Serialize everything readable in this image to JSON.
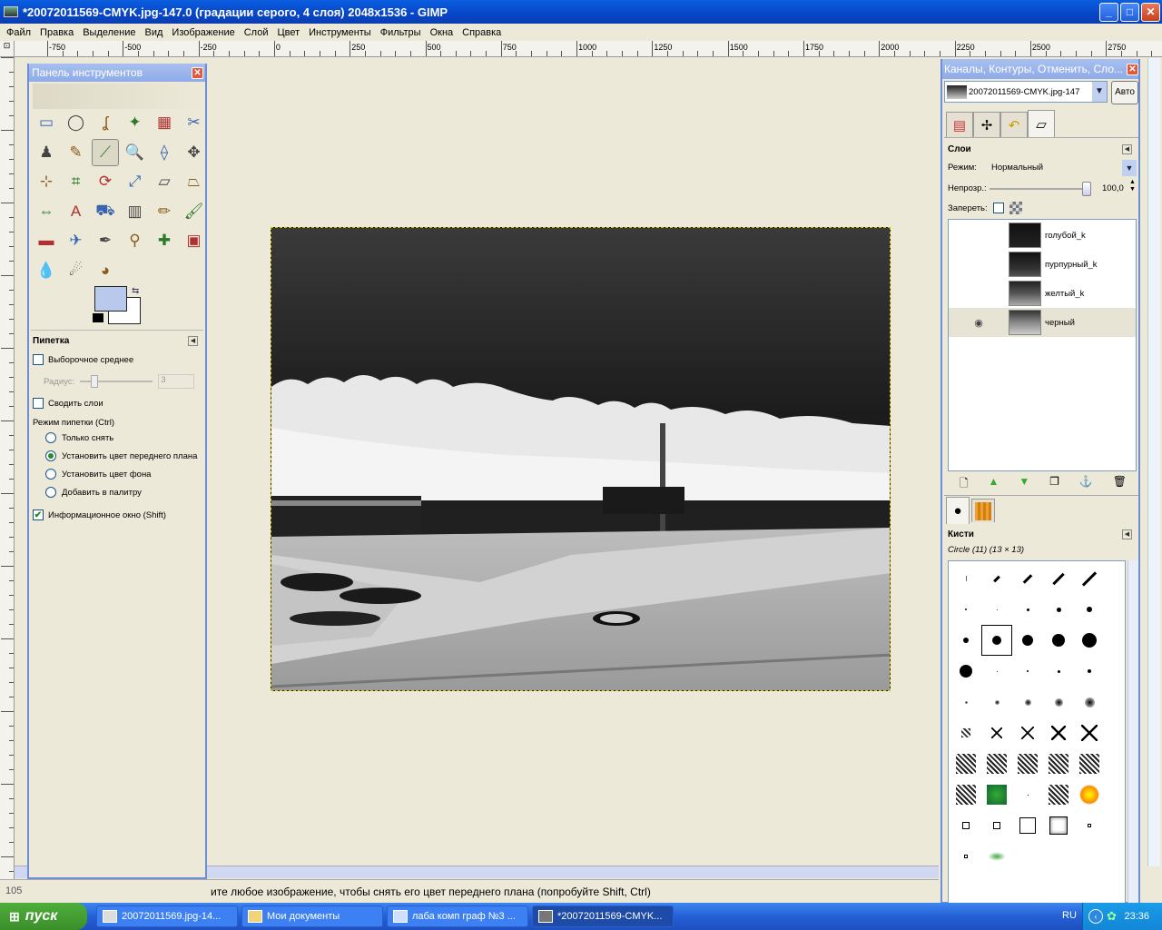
{
  "window": {
    "title": "*20072011569-CMYK.jpg-147.0 (градации серого, 4 слоя) 2048x1536 - GIMP",
    "controls": [
      "_",
      "□",
      "✕"
    ]
  },
  "menu": [
    "Файл",
    "Правка",
    "Выделение",
    "Вид",
    "Изображение",
    "Слой",
    "Цвет",
    "Инструменты",
    "Фильтры",
    "Окна",
    "Справка"
  ],
  "ruler": {
    "h_labels": [
      "-750",
      "-500",
      "-250",
      "0",
      "250",
      "500",
      "750",
      "1000",
      "1250",
      "1500",
      "1750",
      "2000",
      "2250",
      "2500",
      "2750"
    ]
  },
  "status": {
    "zoom": "105",
    "message": "ите любое изображение, чтобы снять его цвет переднего плана (попробуйте Shift, Ctrl)"
  },
  "toolbox": {
    "title": "Панель инструментов",
    "tools": [
      "rect-select",
      "ellipse-select",
      "free-select",
      "fuzzy-select",
      "select-by-color",
      "scissors",
      "foreground-select",
      "paths",
      "color-picker",
      "zoom",
      "measure",
      "move",
      "align",
      "crop",
      "rotate",
      "scale",
      "shear",
      "perspective",
      "flip",
      "text",
      "bucket-fill",
      "blend",
      "pencil",
      "paintbrush",
      "eraser",
      "airbrush",
      "ink",
      "clone",
      "heal",
      "perspective-clone",
      "blur",
      "smudge",
      "dodge-burn"
    ],
    "tool_glyphs": [
      "▭",
      "◯",
      "ʆ",
      "✦",
      "▦",
      "✂",
      "♟",
      "✎",
      "⟋",
      "🔍",
      "⟠",
      "✥",
      "⊹",
      "⌗",
      "⟳",
      "⤢",
      "▱",
      "⏢",
      "⇔",
      "A",
      "⛟",
      "▥",
      "✏",
      "🖌",
      "▬",
      "✈",
      "✒",
      "⚲",
      "✚",
      "▣",
      "💧",
      "☄",
      "◕"
    ],
    "fg_color": "#b8c9ec",
    "bg_color": "#ffffff",
    "options_title": "Пипетка",
    "sample_average": "Выборочное среднее",
    "radius_label": "Радиус:",
    "radius_value": "3",
    "sample_merged": "Сводить слои",
    "mode_title": "Режим пипетки  (Ctrl)",
    "modes": [
      "Только снять",
      "Установить цвет переднего плана",
      "Установить цвет фона",
      "Добавить в палитру"
    ],
    "selected_mode": 1,
    "info_window": "Информационное окно  (Shift)"
  },
  "dock": {
    "title": "Каналы, Контуры, Отменить, Сло...",
    "image_select": "20072011569-CMYK.jpg-147",
    "auto_button": "Авто",
    "tabs": [
      "channels-icon",
      "paths-icon",
      "undo-icon",
      "layers-icon"
    ],
    "layers_title": "Слои",
    "mode_label": "Режим:",
    "mode_value": "Нормальный",
    "opacity_label": "Непрозр.:",
    "opacity_value": "100,0",
    "opacity_fraction": 1.0,
    "lock_label": "Запереть:",
    "layers": [
      {
        "name": "голубой_k",
        "visible": false
      },
      {
        "name": "пурпурный_k",
        "visible": false
      },
      {
        "name": "желтый_k",
        "visible": false
      },
      {
        "name": "черный",
        "visible": true
      }
    ],
    "layer_buttons": [
      "new-layer",
      "raise-layer",
      "lower-layer",
      "duplicate-layer",
      "anchor-layer",
      "delete-layer"
    ],
    "brushes_title": "Кисти",
    "brush_name": "Circle (11) (13 × 13)"
  },
  "taskbar": {
    "start": "пуск",
    "buttons": [
      "20072011569.jpg-14...",
      "Мои документы",
      "лаба комп граф №3 ...",
      "*20072011569-CMYK..."
    ],
    "lang": "RU",
    "time": "23:36"
  }
}
